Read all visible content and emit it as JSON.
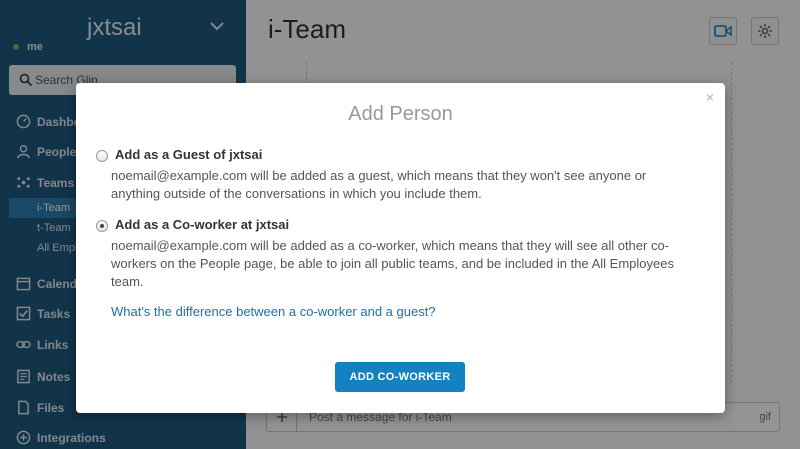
{
  "sidebar": {
    "workspace": "jxtsai",
    "presence": "me",
    "search_placeholder": "Search Glip...",
    "nav": {
      "dashboard": "Dashboard",
      "people": "People",
      "teams": "Teams",
      "calendar": "Calendar",
      "tasks": "Tasks",
      "links": "Links",
      "notes": "Notes",
      "files": "Files",
      "integrations": "Integrations"
    },
    "teams": [
      "i-Team",
      "t-Team",
      "All Employees"
    ]
  },
  "main": {
    "title": "i-Team",
    "composer_placeholder": "Post a message for i-Team",
    "gif_label": "gif"
  },
  "modal": {
    "title": "Add Person",
    "close": "×",
    "guest_label": "Add as a Guest of jxtsai",
    "guest_desc": "noemail@example.com will be added as a guest, which means that they won't see anyone or anything outside of the conversations in which you include them.",
    "coworker_label": "Add as a Co-worker at jxtsai",
    "coworker_desc": "noemail@example.com will be added as a co-worker, which means that they will see all other co-workers on the People page, be able to join all public teams, and be included in the All Employees team.",
    "selected": "coworker",
    "help_link": "What's the difference between a co-worker and a guest?",
    "submit": "ADD CO-WORKER"
  }
}
